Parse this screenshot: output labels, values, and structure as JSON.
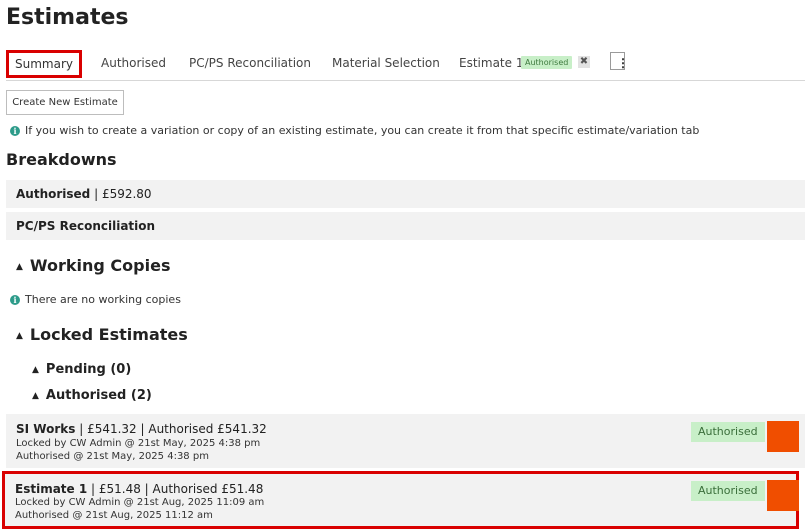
{
  "page_title": "Estimates",
  "tabs": {
    "items": [
      {
        "label": "Summary",
        "active": true
      },
      {
        "label": "Authorised"
      },
      {
        "label": "PC/PS Reconciliation"
      },
      {
        "label": "Material Selection"
      },
      {
        "label": "Estimate 1",
        "badge": "Authorised",
        "close": "✖"
      }
    ],
    "more_icon": "⋮"
  },
  "create_button": "Create New Estimate",
  "info_variation": "If you wish to create a variation or copy of an existing estimate, you can create it from that specific estimate/variation tab",
  "breakdowns": {
    "heading": "Breakdowns",
    "rows": [
      {
        "label": "Authorised",
        "value": " | £592.80"
      },
      {
        "label": "PC/PS Reconciliation",
        "value": ""
      }
    ]
  },
  "working_copies": {
    "heading": "Working Copies",
    "empty": "There are no working copies"
  },
  "locked_estimates": {
    "heading": "Locked Estimates",
    "pending": "Pending (0)",
    "authorised": "Authorised (2)",
    "items": [
      {
        "name": "SI Works",
        "summary": " | £541.32 | Authorised £541.32",
        "locked": "Locked by CW Admin @ 21st May, 2025 4:38 pm",
        "authorised": "Authorised @ 21st May, 2025 4:38 pm",
        "status": "Authorised"
      },
      {
        "name": "Estimate 1",
        "summary": " | £51.48 | Authorised £51.48",
        "locked": "Locked by CW Admin @ 21st Aug, 2025 11:09 am",
        "authorised": "Authorised @ 21st Aug, 2025 11:12 am",
        "status": "Authorised"
      }
    ]
  },
  "icons": {
    "info": "i",
    "caret_up": "▲"
  },
  "colors": {
    "highlight": "#d90000",
    "badge_bg": "#c8efc8",
    "action_orange": "#f04e00",
    "info_teal": "#2d9b8a"
  }
}
